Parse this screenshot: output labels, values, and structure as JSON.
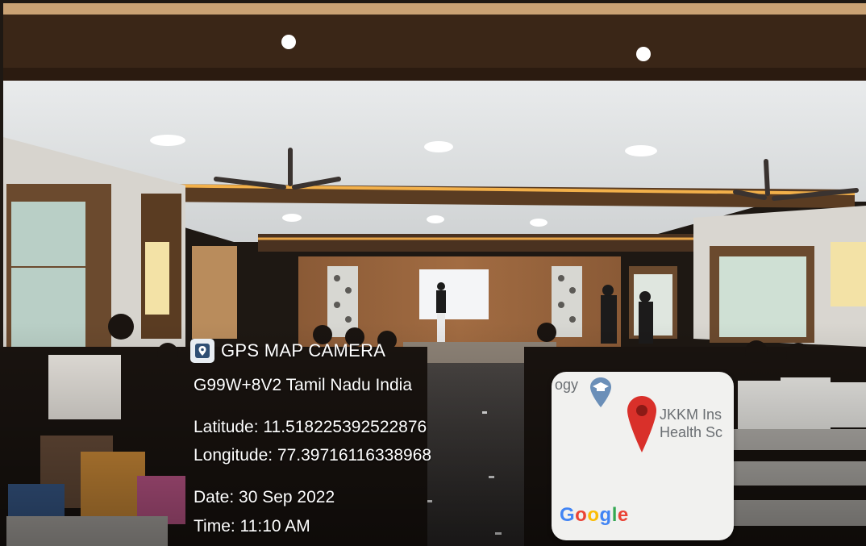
{
  "overlay": {
    "app_name": "GPS MAP CAMERA",
    "address": "G99W+8V2   Tamil Nadu  India",
    "latitude": "Latitude: 11.518225392522876",
    "longitude": "Longitude: 77.39716116338968",
    "date": "Date: 30 Sep 2022",
    "time": "Time: 11:10 AM"
  },
  "map": {
    "label_fragment": "ogy",
    "poi_name_line1": "JKKM Ins",
    "poi_name_line2": "Health Sc",
    "logo_text": "Google",
    "pin_color": "#d9302a",
    "icon_color": "#6b8fb8"
  }
}
